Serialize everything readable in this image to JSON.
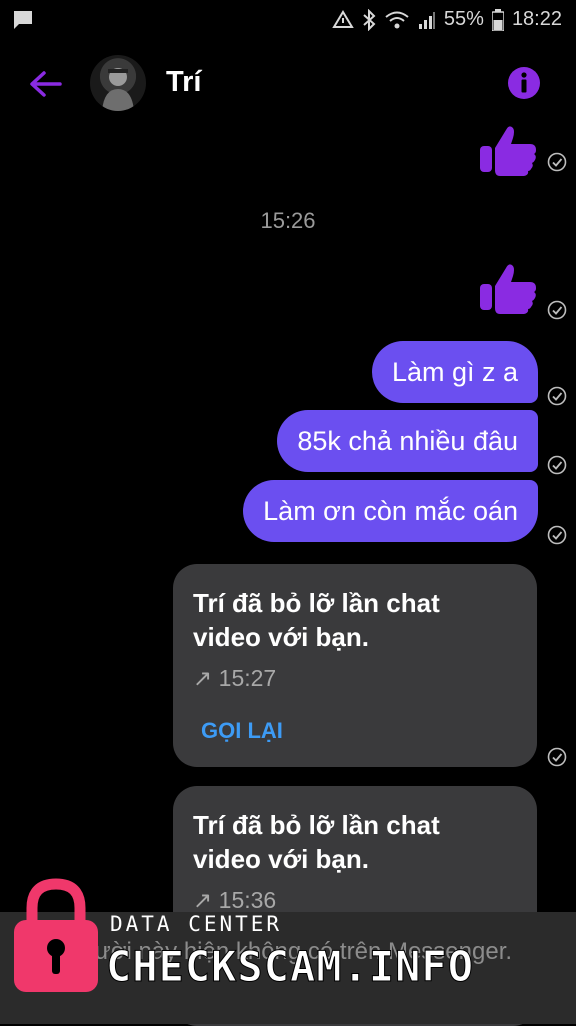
{
  "status_bar": {
    "battery": "55%",
    "time": "18:22"
  },
  "header": {
    "contact_name": "Trí"
  },
  "messages": {
    "time_separator": "15:26",
    "bubbles": [
      "Làm gì z a",
      "85k chả nhiều đâu",
      "Làm ơn còn mắc oán"
    ]
  },
  "missed_calls": [
    {
      "text": "Trí đã bỏ lỡ lần chat video với bạn.",
      "time": "↗ 15:27",
      "action": "GỌI LẠI"
    },
    {
      "text": "Trí đã bỏ lỡ lần chat video với bạn.",
      "time": "↗ 15:36"
    }
  ],
  "footer": {
    "notice": "Người này hiện không có trên Messenger."
  },
  "watermark": {
    "top": "DATA CENTER",
    "main": "CHECKSCAM.INFO"
  },
  "colors": {
    "accent": "#8a2be2",
    "bubble": "#6b4ff0",
    "link": "#3d9bf5",
    "card": "#3a3a3c"
  },
  "icons": [
    "message-icon",
    "sync-icon",
    "bluetooth-icon",
    "wifi-icon",
    "signal-icon",
    "battery-icon",
    "back-arrow-icon",
    "info-icon",
    "thumbs-up-icon",
    "sent-check-icon",
    "lock-icon"
  ]
}
